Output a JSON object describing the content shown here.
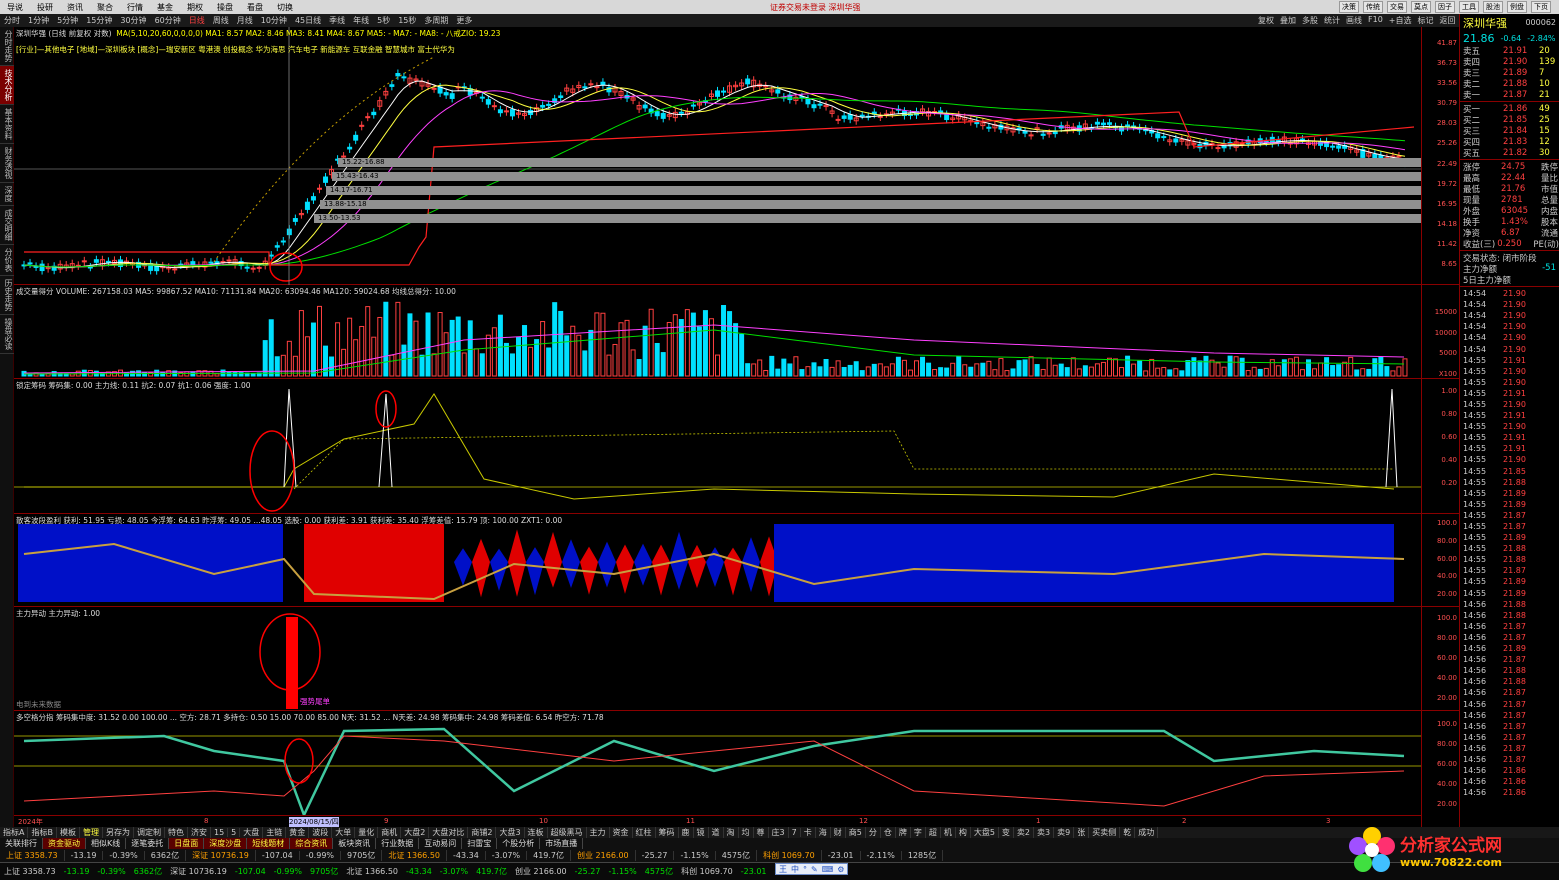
{
  "menu": [
    "导说",
    "投研",
    "资讯",
    "聚合",
    "行情",
    "基金",
    "期权",
    "操盘",
    "看盘",
    "切换"
  ],
  "menu_center": "证券交易未登录    深圳华强",
  "right_btns": [
    "决策",
    "传统",
    "交易",
    "莫点",
    "因子",
    "工具",
    "股池",
    "例盘",
    "下页"
  ],
  "periods": [
    "分时",
    "1分钟",
    "5分钟",
    "15分钟",
    "30分钟",
    "60分钟",
    "日线",
    "周线",
    "月线",
    "10分钟",
    "45日线",
    "季线",
    "年线",
    "5秒",
    "15秒",
    "多周期",
    "更多"
  ],
  "period_active": "日线",
  "toolbar": [
    "复权",
    "叠加",
    "多股",
    "统计",
    "画线",
    "F10",
    "+自选",
    "标记",
    "返回"
  ],
  "left_tabs": [
    "分时走势",
    "技术分析",
    "基本资料",
    "财务透视",
    "深度",
    "成交明细",
    "分价表",
    "历史走势",
    "操盘必读"
  ],
  "panels": {
    "main_title": "深圳华强 (日线 前复权 对数)",
    "main_ma": "MA(5,10,20,60,0,0,0,0)  MA1: 8.57  MA2: 8.46  MA3: 8.41  MA4: 8.67  MA5: -  MA7: -  MA8: -  八戒ZIO: 19.23",
    "main_concepts": "[行业]—其他电子 [地域]—深圳板块 [概念]—瑞安新区 粤港澳 创投概念 华为海思 汽车电子 新能源车 互联金融 智慧城市 富士代华为",
    "main_axis": [
      "41.87",
      "36.73",
      "33.56",
      "30.79",
      "28.03",
      "25.26",
      "22.49",
      "19.72",
      "16.95",
      "14.18",
      "11.42",
      "8.65"
    ],
    "main_annotations": [
      "高点",
      "低点",
      "关键阻",
      "平衡区",
      "关键阻"
    ],
    "chips": [
      "15.22-16.88",
      "15.43-16.43",
      "14.17-16.71",
      "13.88-15.18",
      "13.50-13.53"
    ],
    "vol_title": "成交量得分  VOLUME: 267158.03  MA5: 99867.52  MA10: 71131.84  MA20: 63094.46  MA120: 59024.68  均线总得分: 10.00",
    "vol_axis": [
      "15000",
      "10000",
      "5000",
      "X100"
    ],
    "chip_title": "锁定筹码  筹码集: 0.00  主力线: 0.11  抗2: 0.07  抗1: 0.06  强度: 1.00",
    "chip_axis": [
      "1.00",
      "0.80",
      "0.60",
      "0.40",
      "0.20"
    ],
    "profit_title": "散客波段盈利  获利: 51.95  亏损: 48.05  今浮筹: 64.63  昨浮筹: 49.05  ...48.05  选股: 0.00  获利差: 3.91  获利差: 35.40  浮筹差值: 15.79  顶: 100.00  ZXT1: 0.00",
    "profit_axis": [
      "100.0",
      "80.00",
      "60.00",
      "40.00",
      "20.00"
    ],
    "main_force_title": "主力异动  主力异动: 1.00",
    "main_force_axis": [
      "100.0",
      "80.00",
      "60.00",
      "40.00",
      "20.00"
    ],
    "main_force_note": "电到未来数据",
    "main_force_label": "强势尾单",
    "ls_title": "多空格分指  筹码集中度: 31.52  0.00  100.00  ...  空方: 28.71  多持仓: 0.50  15.00  70.00  85.00  N天: 31.52  ...  N天差: 24.98  筹码集中: 24.98  筹码差值: 6.54  昨空方: 71.78",
    "ls_axis": [
      "100.0",
      "80.00",
      "60.00",
      "40.00",
      "20.00"
    ],
    "date_axis": [
      "2024年",
      "8",
      "2024/08/15/四",
      "9",
      "10",
      "11",
      "12",
      "1",
      "2",
      "3"
    ]
  },
  "quote": {
    "name": "深圳华强",
    "code": "000062",
    "price": "21.86",
    "change": "-0.64",
    "pct": "-2.84%",
    "asks": [
      {
        "label": "卖五",
        "price": "21.91",
        "vol": "20"
      },
      {
        "label": "卖四",
        "price": "21.90",
        "vol": "139"
      },
      {
        "label": "卖三",
        "price": "21.89",
        "vol": "7"
      },
      {
        "label": "卖二",
        "price": "21.88",
        "vol": "10"
      },
      {
        "label": "卖一",
        "price": "21.87",
        "vol": "21"
      }
    ],
    "bids": [
      {
        "label": "买一",
        "price": "21.86",
        "vol": "49"
      },
      {
        "label": "买二",
        "price": "21.85",
        "vol": "25"
      },
      {
        "label": "买三",
        "price": "21.84",
        "vol": "15"
      },
      {
        "label": "买四",
        "price": "21.83",
        "vol": "12"
      },
      {
        "label": "买五",
        "price": "21.82",
        "vol": "30"
      }
    ],
    "stats": [
      {
        "label": "涨停",
        "value": "24.75",
        "k": "跌停"
      },
      {
        "label": "最高",
        "value": "22.44",
        "k": "量比"
      },
      {
        "label": "最低",
        "value": "21.76",
        "k": "市值"
      },
      {
        "label": "现量",
        "value": "2781",
        "k": "总量"
      },
      {
        "label": "外盘",
        "value": "63045",
        "k": "内盘"
      },
      {
        "label": "换手",
        "value": "1.43%",
        "k": "股本"
      },
      {
        "label": "净资",
        "value": "6.87",
        "k": "流通"
      },
      {
        "label": "收益(三)",
        "value": "0.250",
        "k": "PE(动)"
      }
    ],
    "state": "交易状态: 闭市阶段",
    "main_net": "主力净额",
    "main_net_val": "-51",
    "main_net5": "5日主力净额",
    "ticks": [
      [
        "14:54",
        "21.90"
      ],
      [
        "14:54",
        "21.90"
      ],
      [
        "14:54",
        "21.90"
      ],
      [
        "14:54",
        "21.90"
      ],
      [
        "14:54",
        "21.90"
      ],
      [
        "14:54",
        "21.90"
      ],
      [
        "14:55",
        "21.91"
      ],
      [
        "14:55",
        "21.90"
      ],
      [
        "14:55",
        "21.90"
      ],
      [
        "14:55",
        "21.91"
      ],
      [
        "14:55",
        "21.90"
      ],
      [
        "14:55",
        "21.91"
      ],
      [
        "14:55",
        "21.90"
      ],
      [
        "14:55",
        "21.91"
      ],
      [
        "14:55",
        "21.91"
      ],
      [
        "14:55",
        "21.90"
      ],
      [
        "14:55",
        "21.85"
      ],
      [
        "14:55",
        "21.88"
      ],
      [
        "14:55",
        "21.89"
      ],
      [
        "14:55",
        "21.89"
      ],
      [
        "14:55",
        "21.87"
      ],
      [
        "14:55",
        "21.87"
      ],
      [
        "14:55",
        "21.89"
      ],
      [
        "14:55",
        "21.88"
      ],
      [
        "14:55",
        "21.88"
      ],
      [
        "14:55",
        "21.87"
      ],
      [
        "14:55",
        "21.89"
      ],
      [
        "14:55",
        "21.89"
      ],
      [
        "14:56",
        "21.88"
      ],
      [
        "14:56",
        "21.88"
      ],
      [
        "14:56",
        "21.87"
      ],
      [
        "14:56",
        "21.87"
      ],
      [
        "14:56",
        "21.89"
      ],
      [
        "14:56",
        "21.87"
      ],
      [
        "14:56",
        "21.88"
      ],
      [
        "14:56",
        "21.88"
      ],
      [
        "14:56",
        "21.87"
      ],
      [
        "14:56",
        "21.87"
      ],
      [
        "14:56",
        "21.87"
      ],
      [
        "14:56",
        "21.87"
      ],
      [
        "14:56",
        "21.87"
      ],
      [
        "14:56",
        "21.87"
      ],
      [
        "14:56",
        "21.87"
      ],
      [
        "14:56",
        "21.86"
      ],
      [
        "14:56",
        "21.86"
      ],
      [
        "14:56",
        "21.86"
      ]
    ]
  },
  "tabs1": [
    "指标A",
    "指标B",
    "模板",
    "管理",
    "另存为",
    "调定制",
    "特色",
    "济安",
    "15",
    "5",
    "大盘",
    "主链",
    "黄金",
    "波段",
    "大单",
    "量化",
    "商机",
    "大盘2",
    "大盘对比",
    "商铺2",
    "大盘3",
    "连板",
    "超级黑马",
    "主力",
    "资金",
    "红柱",
    "筹码",
    "鹿",
    "镜",
    "道",
    "淘",
    "均",
    "尊",
    "庄3",
    "7",
    "卡",
    "海",
    "财",
    "商5",
    "分",
    "仓",
    "牌",
    "字",
    "超",
    "机",
    "构",
    "大盘5",
    "变",
    "卖2",
    "卖3",
    "卖9",
    "张",
    "买卖侧",
    "乾",
    "成功"
  ],
  "tabs1_active": "管理",
  "tabs2": [
    "关联排行",
    "资金驱动",
    "相似K线",
    "逐笔委托",
    "日盘面",
    "深度沙盘",
    "短线题材",
    "综合资讯",
    "板块资讯",
    "行业数据",
    "互动易问",
    "扫雷宝",
    "个股分析",
    "市场直播"
  ],
  "tabs3": [
    "上证 3358.73",
    "-13.19",
    "-0.39%",
    "6362亿",
    "深证 10736.19",
    "-107.04",
    "-0.99%",
    "9705亿",
    "北证 1366.50",
    "-43.34",
    "-3.07%",
    "419.7亿",
    "创业 2166.00",
    "-25.27",
    "-1.15%",
    "4575亿",
    "科创 1069.70",
    "-23.01",
    "-2.11%",
    "1285亿"
  ],
  "watermark": {
    "title": "分析家公式网",
    "url": "www.70822.com"
  },
  "colors": {
    "up": "#ff4040",
    "down": "#00e0ff",
    "axis": "#8a0000",
    "blue_fill": "#0010c8",
    "red_fill": "#e00000"
  }
}
